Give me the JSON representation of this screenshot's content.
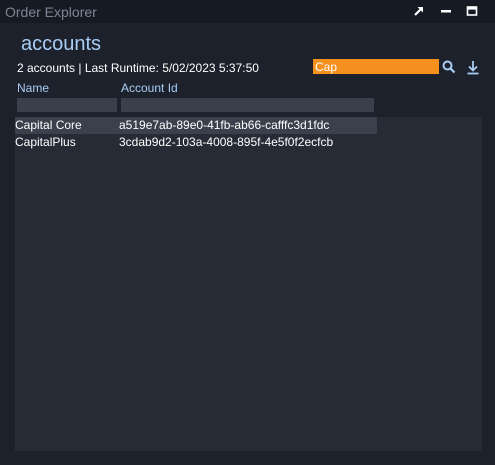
{
  "window": {
    "title": "Order Explorer"
  },
  "header": {
    "title": "accounts",
    "summary": "2 accounts | Last Runtime: 5/02/2023 5:37:50"
  },
  "search": {
    "value": "Cap"
  },
  "table": {
    "columns": [
      "Name",
      "Account Id"
    ],
    "rows": [
      {
        "name": "Capital Core",
        "account_id": "a519e7ab-89e0-41fb-ab66-cafffc3d1fdc",
        "selected": true
      },
      {
        "name": "CapitalPlus",
        "account_id": "3cdab9d2-103a-4008-895f-4e5f0f2ecfcb",
        "selected": false
      }
    ]
  },
  "colors": {
    "accent": "#a9cdf5",
    "search_highlight": "#f5901f",
    "background": "#1c212b"
  },
  "icons": {
    "popout": "popout-icon",
    "minimize": "minimize-icon",
    "maximize": "maximize-icon",
    "search": "search-icon",
    "download": "download-icon"
  }
}
